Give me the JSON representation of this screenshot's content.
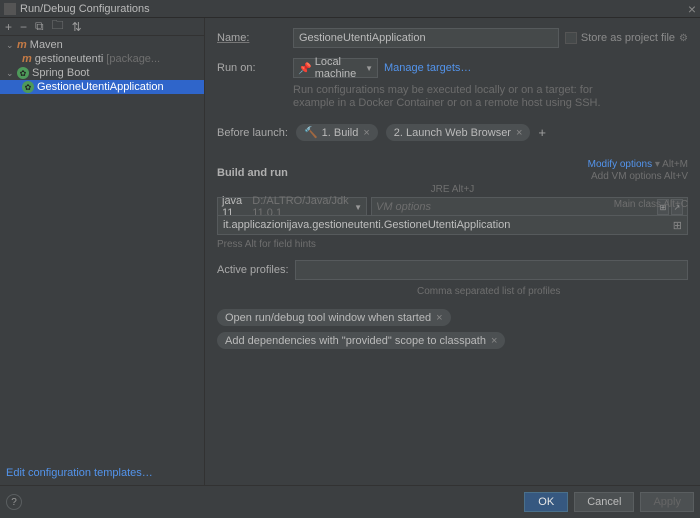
{
  "window": {
    "title": "Run/Debug Configurations"
  },
  "toolbar": {
    "add": "+",
    "remove": "−",
    "copy": "⧉",
    "folder": "🗀",
    "arrows": "⇅"
  },
  "tree": {
    "maven": {
      "label": "Maven",
      "child_label": "gestioneutenti",
      "child_hint": "[package..."
    },
    "springboot": {
      "label": "Spring Boot",
      "child_label": "GestioneUtentiApplication"
    }
  },
  "nameRow": {
    "label": "Name:",
    "value": "GestioneUtentiApplication",
    "store": "Store as project file"
  },
  "runon": {
    "label": "Run on:",
    "value": "Local machine",
    "manage": "Manage targets…",
    "desc1": "Run configurations may be executed locally or on a target: for",
    "desc2": "example in a Docker Container or on a remote host using SSH."
  },
  "before": {
    "label": "Before launch:",
    "chip1": "1. Build",
    "chip2": "2. Launch Web Browser"
  },
  "build": {
    "title": "Build and run",
    "modify": "Modify options",
    "modify_sc": "Alt+M",
    "addvm": "Add VM options",
    "addvm_sc": "Alt+V",
    "jre_hint": "JRE Alt+J",
    "jdk_name": "java 11",
    "jdk_path": "D:/ALTRO/Java/Jdk 11.0.1",
    "vm_placeholder": "VM options",
    "mainclass": "it.applicazionijava.gestioneutenti.GestioneUtentiApplication",
    "mainclass_hint": "Main class Alt+C",
    "fieldhint": "Press Alt for field hints"
  },
  "profiles": {
    "label": "Active profiles:",
    "hint": "Comma separated list of profiles"
  },
  "chips": {
    "c1": "Open run/debug tool window when started",
    "c2": "Add dependencies with \"provided\" scope to classpath"
  },
  "templates": "Edit configuration templates…",
  "footer": {
    "ok": "OK",
    "cancel": "Cancel",
    "apply": "Apply"
  }
}
